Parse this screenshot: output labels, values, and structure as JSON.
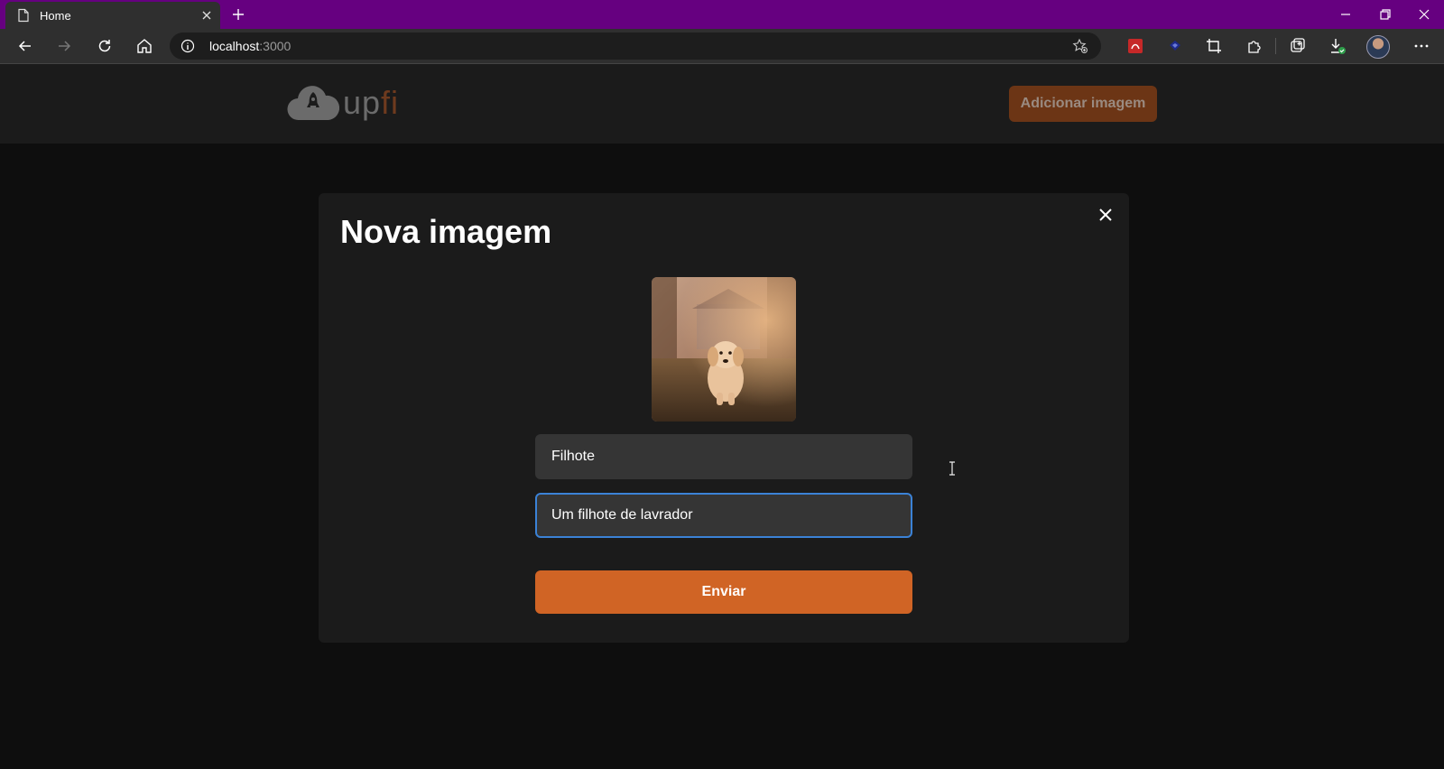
{
  "browser": {
    "tab_title": "Home",
    "address_host": "localhost",
    "address_port": ":3000"
  },
  "app": {
    "logo_up": "up",
    "logo_fi": "fi",
    "add_image_button": "Adicionar imagem"
  },
  "modal": {
    "title": "Nova imagem",
    "title_field_value": "Filhote",
    "description_field_value": "Um filhote de lavrador",
    "submit_label": "Enviar"
  },
  "colors": {
    "tabbar": "#660080",
    "accent": "#d06425",
    "focus_border": "#3b82d6"
  }
}
